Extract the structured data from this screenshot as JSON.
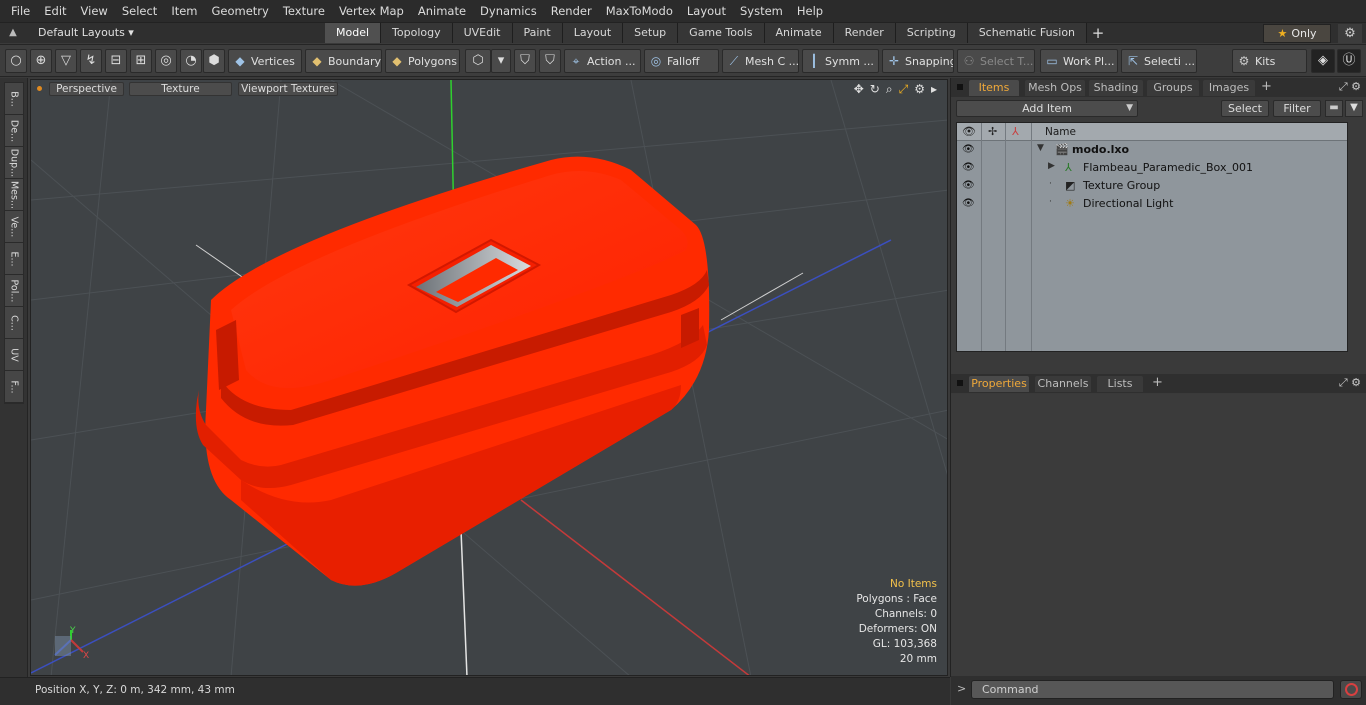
{
  "menu": [
    "File",
    "Edit",
    "View",
    "Select",
    "Item",
    "Geometry",
    "Texture",
    "Vertex Map",
    "Animate",
    "Dynamics",
    "Render",
    "MaxToModo",
    "Layout",
    "System",
    "Help"
  ],
  "layout_bar": {
    "layout_select": "Default Layouts ▾",
    "tabs": [
      "Model",
      "Topology",
      "UVEdit",
      "Paint",
      "Layout",
      "Setup",
      "Game Tools",
      "Animate",
      "Render",
      "Scripting",
      "Schematic Fusion"
    ],
    "active_tab": "Model",
    "add_label": "+",
    "only_label": "Only"
  },
  "toolbar": {
    "vertices": "Vertices",
    "boundary": "Boundary",
    "polygons": "Polygons",
    "action": "Action ...",
    "falloff": "Falloff",
    "mesh_c": "Mesh C ...",
    "symm": "Symm ...",
    "snapping": "Snapping",
    "select_t": "Select T...",
    "work_pl": "Work Pl...",
    "selecti": "Selecti ...",
    "kits": "Kits"
  },
  "left_tabs": [
    "B...",
    "De...",
    "Dup...",
    "Mes...",
    "Ve...",
    "E...",
    "Pol...",
    "C...",
    "UV",
    "F..."
  ],
  "viewport": {
    "perspective": "Perspective",
    "texture": "Texture",
    "viewport_textures": "Viewport Textures",
    "stats": {
      "no_items": "No Items",
      "polygons": "Polygons : Face",
      "channels": "Channels: 0",
      "deformers": "Deformers: ON",
      "gl": "GL: 103,368",
      "scale": "20 mm"
    },
    "axis_y": "Y",
    "axis_x": "X"
  },
  "status": {
    "position": "Position X, Y, Z:   0 m, 342 mm, 43 mm"
  },
  "items_panel": {
    "tabs": [
      "Items",
      "Mesh Ops",
      "Shading",
      "Groups",
      "Images"
    ],
    "active_tab": "Items",
    "add_item": "Add Item",
    "select": "Select",
    "filter": "Filter",
    "name_header": "Name",
    "rows": [
      {
        "label": "modo.lxo"
      },
      {
        "label": "Flambeau_Paramedic_Box_001"
      },
      {
        "label": "Texture Group"
      },
      {
        "label": "Directional Light"
      }
    ]
  },
  "props_panel": {
    "tabs": [
      "Properties",
      "Channels",
      "Lists"
    ],
    "active_tab": "Properties"
  },
  "command": {
    "placeholder": "Command"
  },
  "colors": {
    "accent_orange": "#f0a93a",
    "model_red": "#ff2a00",
    "list_bg": "#8f969c"
  }
}
